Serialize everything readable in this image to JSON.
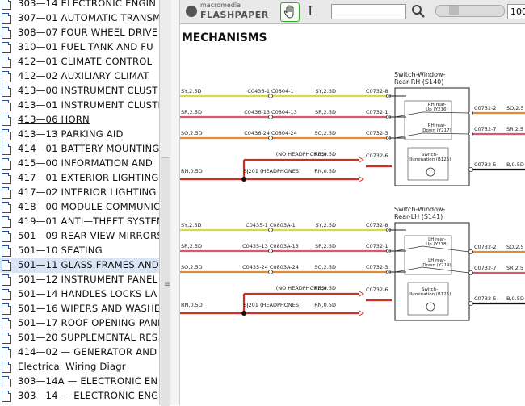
{
  "tree": {
    "items": [
      {
        "label": "303—14 ELECTRONIC ENGIN"
      },
      {
        "label": "307—01 AUTOMATIC TRANSM"
      },
      {
        "label": "308—07 FOUR WHEEL DRIVE"
      },
      {
        "label": "310—01 FUEL TANK AND FU"
      },
      {
        "label": "412—01 CLIMATE CONTROL"
      },
      {
        "label": "412—02 AUXILIARY CLIMAT"
      },
      {
        "label": "413—00 INSTRUMENT CLUST"
      },
      {
        "label": "413—01 INSTRUMENT CLUSTE"
      },
      {
        "label": "413—06 HORN"
      },
      {
        "label": "413—13 PARKING AID"
      },
      {
        "label": "414—01 BATTERY MOUNTING"
      },
      {
        "label": "415—00 INFORMATION AND"
      },
      {
        "label": "417—01 EXTERIOR LIGHTING"
      },
      {
        "label": "417—02 INTERIOR LIGHTING"
      },
      {
        "label": "418—00 MODULE COMMUNICA"
      },
      {
        "label": "419—01 ANTI—THEFT SYSTEM"
      },
      {
        "label": "501—09 REAR VIEW MIRRORS"
      },
      {
        "label": "501—10 SEATING"
      },
      {
        "label": "501—11 GLASS FRAMES AND"
      },
      {
        "label": "501—12 INSTRUMENT PANEL"
      },
      {
        "label": "501—14 HANDLES LOCKS LA"
      },
      {
        "label": "501—16 WIPERS AND WASHEI"
      },
      {
        "label": "501—17 ROOF OPENING PANE"
      },
      {
        "label": "501—20 SUPPLEMENTAL RES"
      },
      {
        "label": "414—02 — GENERATOR AND"
      },
      {
        "label": "Electrical Wiring Diagr"
      },
      {
        "label": "303—14A — ELECTRONIC EN"
      },
      {
        "label": "303—14 — ELECTRONIC ENG"
      }
    ],
    "selected_label": "501—11 GLASS FRAMES AND",
    "underlined_label": "413—06 HORN"
  },
  "toolbar": {
    "brand_small": "macromedia",
    "brand_big": "FLASHPAPER",
    "zoom_value": "100",
    "icons": [
      "hand-icon",
      "text-select-icon",
      "search-icon",
      "zoom-slider"
    ]
  },
  "diagram": {
    "title": "MECHANISMS",
    "grip": "≡",
    "colors": {
      "SY": "#d8d84a",
      "SR": "#d85a6a",
      "SO": "#e08a3a",
      "RN": "#d03020",
      "B": "#111111"
    },
    "blocks": [
      {
        "switch_title_1": "Switch-Window-",
        "switch_title_2": "Rear-RH (S140)",
        "up_label_1": "RH rear-",
        "up_label_2": "Up (Y216)",
        "down_label_1": "RH rear-",
        "down_label_2": "Down (Y217)",
        "illum_label_1": "Switch-",
        "illum_label_2": "Illumination (B125)",
        "rows": [
          {
            "left": "SY,2.5D",
            "conn": "C0436-1  C0804-1",
            "mid": "SY,2.5D",
            "pin": "C0732-8",
            "color": "SY"
          },
          {
            "left": "SR,2.5D",
            "conn": "C0436-13  C0804-13",
            "mid": "SR,2.5D",
            "pin": "C0732-1",
            "color": "SR"
          },
          {
            "left": "SO,2.5D",
            "conn": "C0436-24  C0804-24",
            "mid": "SO,2.5D",
            "pin": "C0732-3",
            "color": "SO"
          },
          {
            "left": "",
            "conn": "(NO HEADPHONES)",
            "mid": "RN,0.5D",
            "pin": "C0732-6",
            "color": "RN"
          },
          {
            "left": "RN,0.5D",
            "conn": "SJ201  (HEADPHONES)",
            "mid": "RN,0.5D",
            "pin": "",
            "color": "RN"
          }
        ],
        "outputs": [
          {
            "pin": "C0732-2",
            "label": "SO,2.5",
            "color": "SO"
          },
          {
            "pin": "C0732-7",
            "label": "SR,2.5",
            "color": "SR"
          },
          {
            "pin": "C0732-5",
            "label": "B,0.5D",
            "color": "B"
          }
        ]
      },
      {
        "switch_title_1": "Switch-Window-",
        "switch_title_2": "Rear-LH (S141)",
        "up_label_1": "LH rear-",
        "up_label_2": "Up (Y218)",
        "down_label_1": "LH rear-",
        "down_label_2": "Down (Y219)",
        "illum_label_1": "Switch-",
        "illum_label_2": "Illumination (B125)",
        "rows": [
          {
            "left": "SY,2.5D",
            "conn": "C0435-1  C0803A-1",
            "mid": "SY,2.5D",
            "pin": "C0732-8",
            "color": "SY"
          },
          {
            "left": "SR,2.5D",
            "conn": "C0435-13  C0803A-13",
            "mid": "SR,2.5D",
            "pin": "C0732-1",
            "color": "SR"
          },
          {
            "left": "SO,2.5D",
            "conn": "C0435-24  C0803A-24",
            "mid": "SO,2.5D",
            "pin": "C0732-3",
            "color": "SO"
          },
          {
            "left": "",
            "conn": "(NO HEADPHONES)",
            "mid": "RN,0.5D",
            "pin": "C0732-6",
            "color": "RN"
          },
          {
            "left": "RN,0.5D",
            "conn": "SJ201  (HEADPHONES)",
            "mid": "RN,0.5D",
            "pin": "",
            "color": "RN"
          }
        ],
        "outputs": [
          {
            "pin": "C0732-2",
            "label": "SO,2.5",
            "color": "SO"
          },
          {
            "pin": "C0732-7",
            "label": "SR,2.5",
            "color": "SR"
          },
          {
            "pin": "C0732-5",
            "label": "B,0.5D",
            "color": "B"
          }
        ]
      }
    ]
  }
}
